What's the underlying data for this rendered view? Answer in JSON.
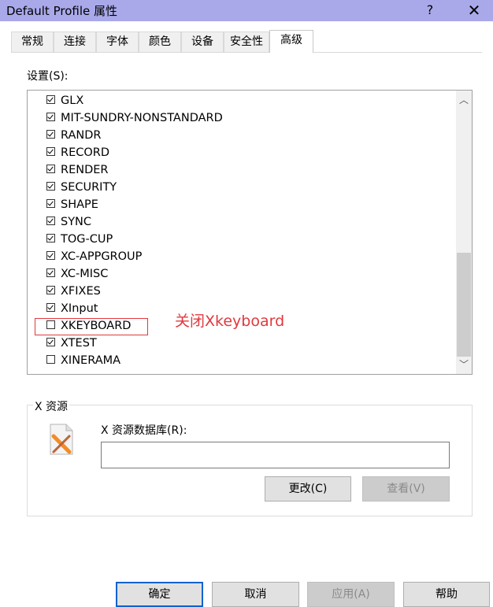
{
  "window": {
    "title": "Default Profile 属性",
    "help_glyph": "?",
    "close_glyph": "✕"
  },
  "tabs": [
    {
      "label": "常规",
      "active": false
    },
    {
      "label": "连接",
      "active": false
    },
    {
      "label": "字体",
      "active": false
    },
    {
      "label": "颜色",
      "active": false
    },
    {
      "label": "设备",
      "active": false
    },
    {
      "label": "安全性",
      "active": false
    },
    {
      "label": "高级",
      "active": true
    }
  ],
  "settings": {
    "label": "设置(S):",
    "items": [
      {
        "label": "GLX",
        "checked": true
      },
      {
        "label": "MIT-SUNDRY-NONSTANDARD",
        "checked": true
      },
      {
        "label": "RANDR",
        "checked": true
      },
      {
        "label": "RECORD",
        "checked": true
      },
      {
        "label": "RENDER",
        "checked": true
      },
      {
        "label": "SECURITY",
        "checked": true
      },
      {
        "label": "SHAPE",
        "checked": true
      },
      {
        "label": "SYNC",
        "checked": true
      },
      {
        "label": "TOG-CUP",
        "checked": true
      },
      {
        "label": "XC-APPGROUP",
        "checked": true
      },
      {
        "label": "XC-MISC",
        "checked": true
      },
      {
        "label": "XFIXES",
        "checked": true
      },
      {
        "label": "XInput",
        "checked": true
      },
      {
        "label": "XKEYBOARD",
        "checked": false
      },
      {
        "label": "XTEST",
        "checked": true
      },
      {
        "label": "XINERAMA",
        "checked": false
      }
    ],
    "scroll_up_glyph": "︿",
    "scroll_down_glyph": "﹀"
  },
  "annotation": "关闭Xkeyboard",
  "annotation_color": "#e0393e",
  "x_resources": {
    "legend": "X 资源",
    "icon": "x-app-icon",
    "db_label": "X 资源数据库(R):",
    "db_value": "",
    "change_label": "更改(C)",
    "view_label": "查看(V)"
  },
  "footer": {
    "ok_label": "确定",
    "cancel_label": "取消",
    "apply_label": "应用(A)",
    "help_label": "帮助"
  },
  "colors": {
    "titlebar": "#a9a9ea",
    "default_button_border": "#0a62d0"
  }
}
